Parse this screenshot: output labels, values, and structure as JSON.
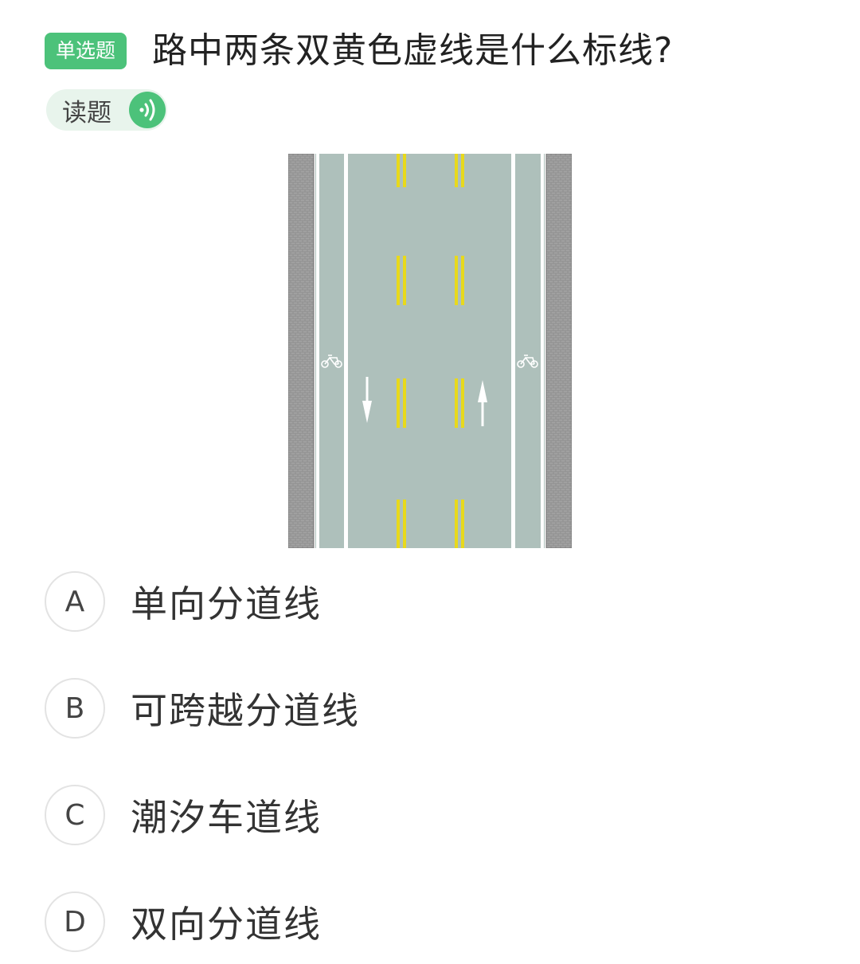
{
  "question": {
    "type_tag": "单选题",
    "text": "路中两条双黄色虚线是什么标线?",
    "read_label": "读题"
  },
  "colors": {
    "accent": "#4cc27a",
    "read_bg": "#e8f4ec",
    "road": "#aec0bb",
    "curb": "#8a8a8a",
    "yellow_line": "#e8d91c"
  },
  "icons": {
    "speaker": "speaker-icon",
    "bicycle": "bicycle-icon",
    "arrow_down": "arrow-down-icon",
    "arrow_up": "arrow-up-icon"
  },
  "options": [
    {
      "letter": "A",
      "text": "单向分道线"
    },
    {
      "letter": "B",
      "text": "可跨越分道线"
    },
    {
      "letter": "C",
      "text": "潮汐车道线"
    },
    {
      "letter": "D",
      "text": "双向分道线"
    }
  ]
}
